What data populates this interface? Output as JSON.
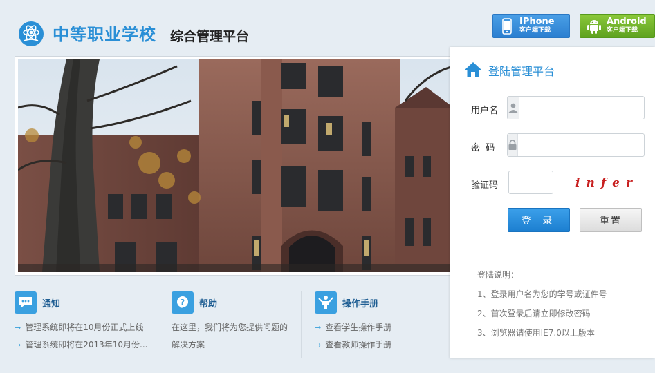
{
  "header": {
    "school_name": "中等职业学校",
    "platform_name": "综合管理平台",
    "download_iphone": {
      "title": "IPhone",
      "subtitle": "客户端下载"
    },
    "download_android": {
      "title": "Android",
      "subtitle": "客户端下载"
    }
  },
  "info": {
    "notice": {
      "title": "通知",
      "items": [
        "管理系统即将在10月份正式上线",
        "管理系统即将在2013年10月份..."
      ]
    },
    "help": {
      "title": "帮助",
      "text": "在这里，我们将为您提供问题的解决方案"
    },
    "manual": {
      "title": "操作手册",
      "items": [
        "查看学生操作手册",
        "查看教师操作手册"
      ]
    }
  },
  "login": {
    "title": "登陆管理平台",
    "username_label": "用户名",
    "password_label": "密  码",
    "captcha_label": "验证码",
    "captcha_text": "infer",
    "login_button": "登 录",
    "reset_button": "重置",
    "notes_title": "登陆说明：",
    "notes": [
      "1、登录用户名为您的学号或证件号",
      "2、首次登录后请立即修改密码",
      "3、浏览器请使用IE7.0以上版本"
    ]
  },
  "colors": {
    "accent": "#2a8fd6",
    "iphone_button": "#3a8fdc",
    "android_button": "#72b52a",
    "captcha": "#c82020"
  },
  "icons": {
    "logo": "atom-book-icon",
    "iphone": "phone-icon",
    "android": "android-icon",
    "notice": "chat-bubble-icon",
    "help": "question-icon",
    "manual": "person-presenting-icon",
    "login": "home-icon",
    "username": "user-icon",
    "password": "lock-icon"
  }
}
